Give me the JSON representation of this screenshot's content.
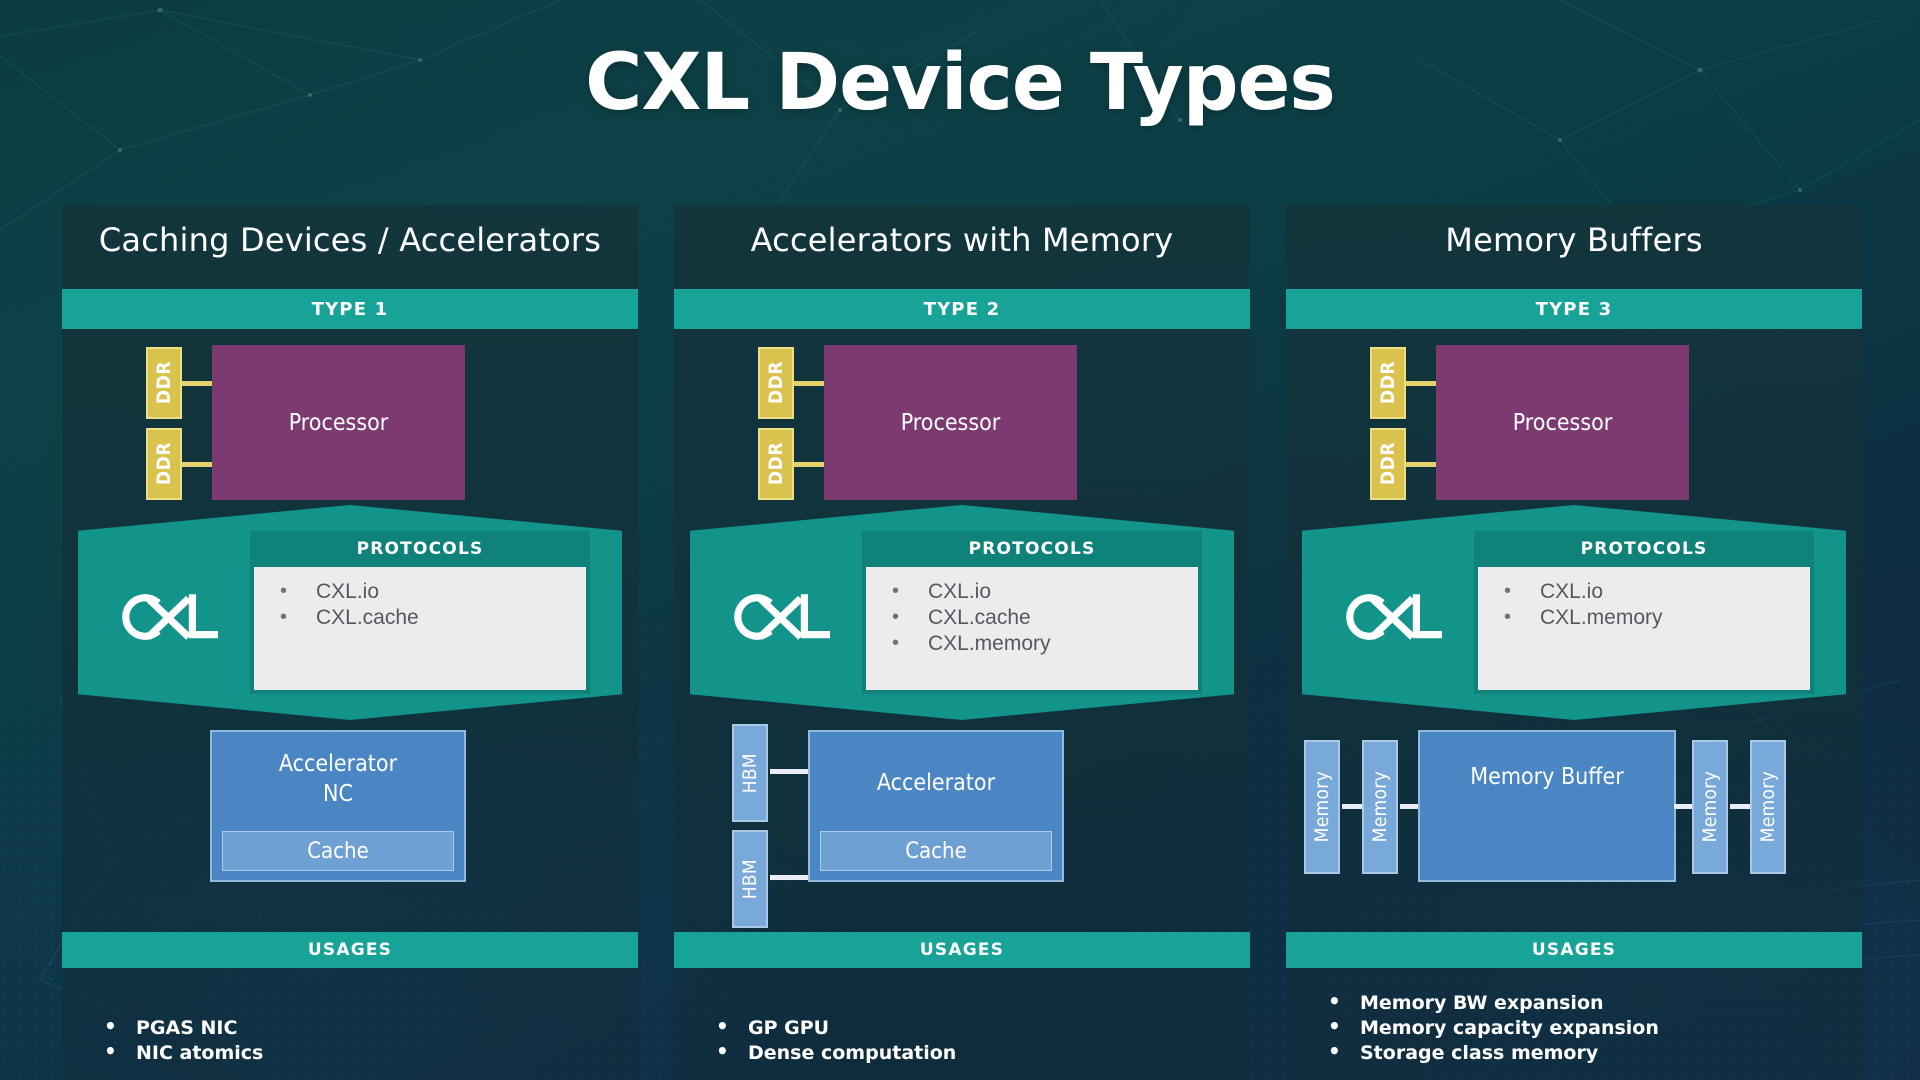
{
  "title": "CXL Device Types",
  "labels": {
    "protocols_heading": "PROTOCOLS",
    "usages_heading": "USAGES",
    "cxl_logo": "CXL",
    "processor": "Processor",
    "ddr": "DDR",
    "hbm": "HBM",
    "memory": "Memory",
    "cache": "Cache"
  },
  "colors": {
    "accent_teal": "#17a398",
    "hex_teal": "#13948b",
    "proto_head_teal": "#0f8279",
    "processor_purple": "#7c3a70",
    "ddr_gold": "#d9c24e",
    "device_blue": "#4a86c4",
    "cache_blue": "#6fa0d3",
    "memory_blue": "#78a9d9",
    "panel_dark": "#13343b",
    "background_teal": "#0c3b41"
  },
  "columns": [
    {
      "heading": "Caching Devices / Accelerators",
      "type_label": "TYPE 1",
      "memory_side_label": null,
      "memory_side_count": 0,
      "processor": "Processor",
      "ddr_labels": [
        "DDR",
        "DDR"
      ],
      "protocols": [
        "CXL.io",
        "CXL.cache"
      ],
      "device": {
        "title_lines": [
          "Accelerator",
          "NC"
        ],
        "sub_label": "Cache",
        "flanking": []
      },
      "usages": [
        "PGAS NIC",
        "NIC atomics"
      ]
    },
    {
      "heading": "Accelerators with Memory",
      "type_label": "TYPE 2",
      "processor": "Processor",
      "ddr_labels": [
        "DDR",
        "DDR"
      ],
      "protocols": [
        "CXL.io",
        "CXL.cache",
        "CXL.memory"
      ],
      "device": {
        "title_lines": [
          "Accelerator"
        ],
        "sub_label": "Cache",
        "flanking": [
          "HBM",
          "HBM"
        ]
      },
      "usages": [
        "GP GPU",
        "Dense computation"
      ]
    },
    {
      "heading": "Memory Buffers",
      "type_label": "TYPE 3",
      "processor": "Processor",
      "ddr_labels": [
        "DDR",
        "DDR"
      ],
      "protocols": [
        "CXL.io",
        "CXL.memory"
      ],
      "device": {
        "title_lines": [
          "Memory Buffer"
        ],
        "sub_label": null,
        "flanking": [
          "Memory",
          "Memory",
          "Memory",
          "Memory"
        ]
      },
      "usages": [
        "Memory BW expansion",
        "Memory capacity expansion",
        "Storage class memory"
      ]
    }
  ]
}
